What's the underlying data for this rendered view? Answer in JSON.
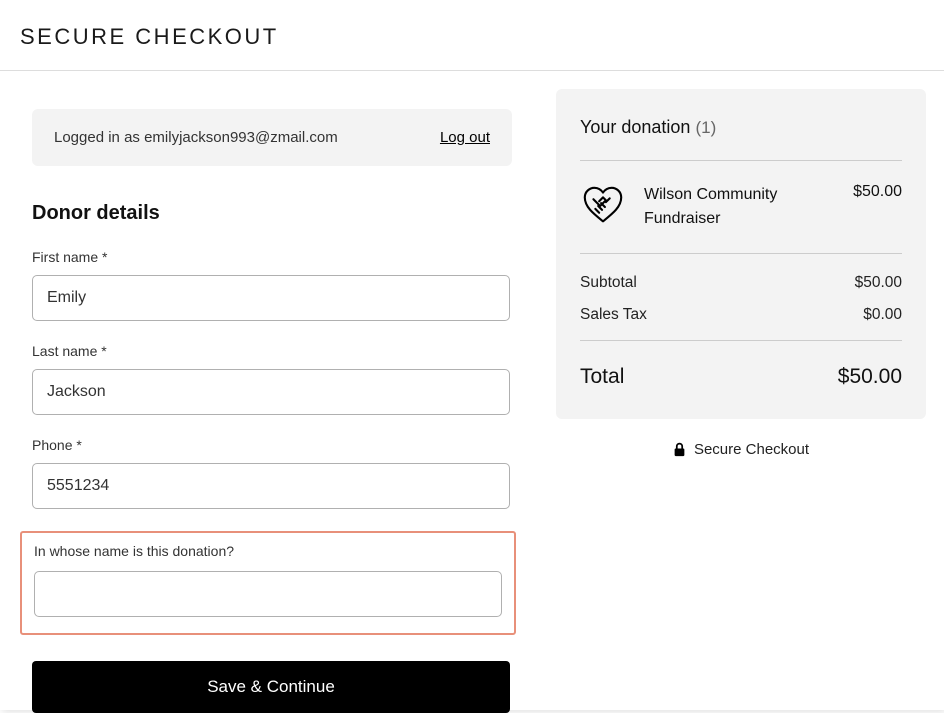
{
  "header": {
    "title": "SECURE CHECKOUT"
  },
  "auth": {
    "logged_in_as_prefix": "Logged in as ",
    "email": "emilyjackson993@zmail.com",
    "logout_label": "Log out"
  },
  "form": {
    "section_title": "Donor details",
    "first_name": {
      "label": "First name *",
      "value": "Emily"
    },
    "last_name": {
      "label": "Last name *",
      "value": "Jackson"
    },
    "phone": {
      "label": "Phone *",
      "value": "5551234"
    },
    "honoree": {
      "label": "In whose name is this donation?",
      "value": ""
    },
    "submit_label": "Save & Continue"
  },
  "summary": {
    "title": "Your donation",
    "count": "(1)",
    "item": {
      "name": "Wilson Community Fundraiser",
      "amount": "$50.00"
    },
    "subtotal": {
      "label": "Subtotal",
      "value": "$50.00"
    },
    "tax": {
      "label": "Sales Tax",
      "value": "$0.00"
    },
    "total": {
      "label": "Total",
      "value": "$50.00"
    },
    "secure_label": "Secure Checkout"
  }
}
